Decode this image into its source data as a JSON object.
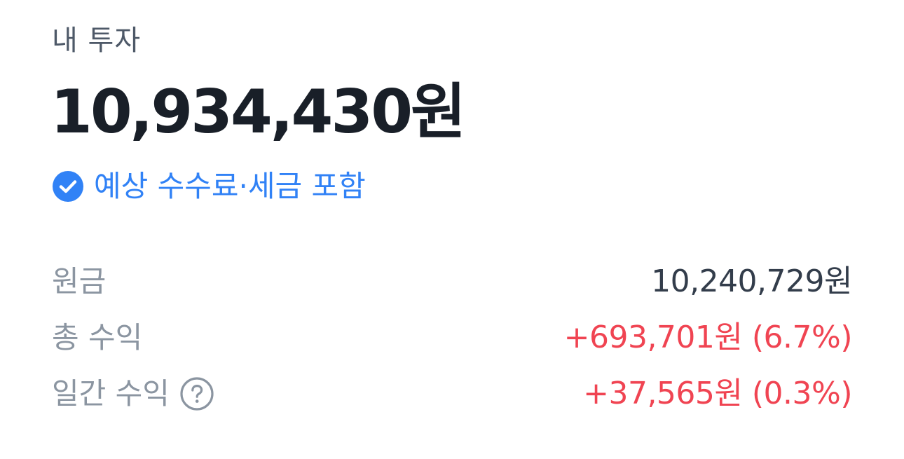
{
  "header": {
    "title": "내 투자"
  },
  "summary": {
    "total_value": "10,934,430원",
    "fee_note": "예상 수수료·세금 포함",
    "fee_note_icon": "check-circle-icon"
  },
  "rows": [
    {
      "label": "원금",
      "value": "10,240,729원",
      "tone": "neutral"
    },
    {
      "label": "총 수익",
      "value": "+693,701원 (6.7%)",
      "tone": "up"
    },
    {
      "label": "일간 수익",
      "value": "+37,565원 (0.3%)",
      "tone": "up",
      "help_icon": "question-circle-icon"
    }
  ],
  "colors": {
    "accent": "#3182f6",
    "up": "#f04452",
    "label": "#8b95a1",
    "title": "#191f28"
  }
}
